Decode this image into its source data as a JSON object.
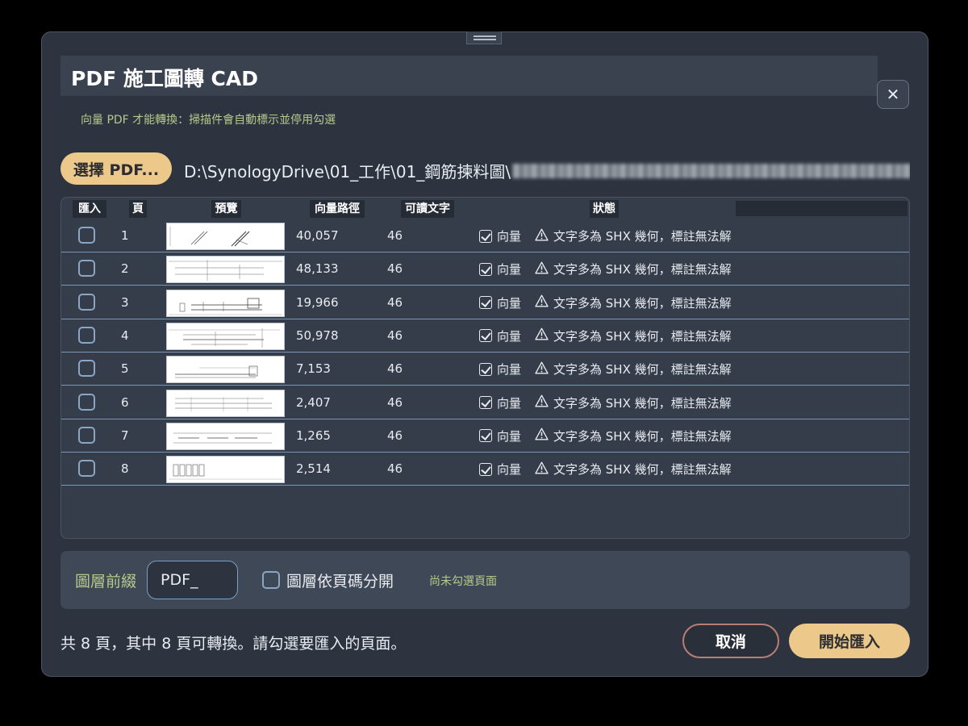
{
  "dialog": {
    "title": "PDF 施工圖轉 CAD",
    "close_icon": "close-icon",
    "close_glyph": "✕",
    "notice": "向量 PDF 才能轉換：掃描件會自動標示並停用勾選"
  },
  "file": {
    "pick_label": "選擇 PDF...",
    "path": "D:\\SynologyDrive\\01_工作\\01_鋼筋揀料圖\\"
  },
  "table": {
    "headers": {
      "import": "匯入",
      "page": "頁",
      "preview": "預覽",
      "vector_paths": "向量路徑",
      "readable_text": "可讀文字",
      "status": "狀態"
    },
    "rows": [
      {
        "page": "1",
        "vector_paths": "40,057",
        "readable_text": "46",
        "vector_label": "向量",
        "warning": "文字多為 SHX 幾何，標註無法解",
        "checked": false
      },
      {
        "page": "2",
        "vector_paths": "48,133",
        "readable_text": "46",
        "vector_label": "向量",
        "warning": "文字多為 SHX 幾何，標註無法解",
        "checked": false
      },
      {
        "page": "3",
        "vector_paths": "19,966",
        "readable_text": "46",
        "vector_label": "向量",
        "warning": "文字多為 SHX 幾何，標註無法解",
        "checked": false
      },
      {
        "page": "4",
        "vector_paths": "50,978",
        "readable_text": "46",
        "vector_label": "向量",
        "warning": "文字多為 SHX 幾何，標註無法解",
        "checked": false
      },
      {
        "page": "5",
        "vector_paths": "7,153",
        "readable_text": "46",
        "vector_label": "向量",
        "warning": "文字多為 SHX 幾何，標註無法解",
        "checked": false
      },
      {
        "page": "6",
        "vector_paths": "2,407",
        "readable_text": "46",
        "vector_label": "向量",
        "warning": "文字多為 SHX 幾何，標註無法解",
        "checked": false
      },
      {
        "page": "7",
        "vector_paths": "1,265",
        "readable_text": "46",
        "vector_label": "向量",
        "warning": "文字多為 SHX 幾何，標註無法解",
        "checked": false
      },
      {
        "page": "8",
        "vector_paths": "2,514",
        "readable_text": "46",
        "vector_label": "向量",
        "warning": "文字多為 SHX 幾何，標註無法解",
        "checked": false
      }
    ]
  },
  "layer": {
    "prefix_label": "圖層前綴",
    "prefix_value": "PDF_",
    "split_label": "圖層依頁碼分開",
    "split_checked": false,
    "hint": "尚未勾選頁面"
  },
  "footer": {
    "summary": "共 8 頁，其中 8 頁可轉換。請勾選要匯入的頁面。",
    "cancel_label": "取消",
    "start_label": "開始匯入"
  },
  "colors": {
    "accent": "#ecc98a",
    "hint_green": "#b7c98a",
    "dialog_bg": "#2d3440",
    "row_border": "#7c95b2"
  }
}
